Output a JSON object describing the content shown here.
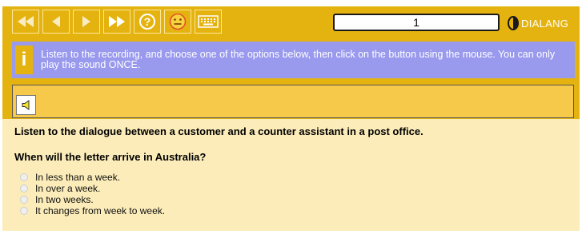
{
  "toolbar": {
    "icons": [
      "skip-back-icon",
      "previous-icon",
      "next-icon",
      "skip-forward-icon",
      "help-icon",
      "feedback-smiley-icon",
      "keyboard-icon"
    ]
  },
  "page": {
    "number": "1"
  },
  "brand": {
    "name": "DIALANG"
  },
  "instructions": {
    "text": "Listen to the recording, and choose one of the options below, then click on the button using the mouse. You can only play the sound ONCE."
  },
  "task": {
    "prompt": "Listen to the dialogue between a customer and a counter assistant in a post office.",
    "question": "When will the letter arrive in Australia?",
    "options": [
      "In less than a week.",
      "In over a week.",
      "In two weeks.",
      "It changes from week to week."
    ]
  },
  "colors": {
    "accent": "#e5b310",
    "info_bar": "#9999ee",
    "content_bg": "#fbecb9"
  }
}
